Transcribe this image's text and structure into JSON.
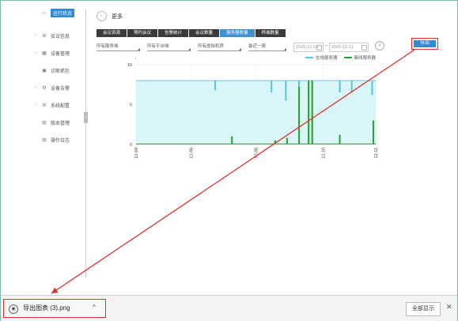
{
  "sidebar": {
    "items": [
      {
        "label": "运行状态",
        "icon": "tv-icon",
        "active": true,
        "expandable": false
      },
      {
        "label": "会议信息",
        "icon": "gear-icon",
        "active": false,
        "expandable": true
      },
      {
        "label": "设备管理",
        "icon": "grid-icon",
        "active": false,
        "expandable": true
      },
      {
        "label": "诊断抓包",
        "icon": "package-icon",
        "active": false,
        "expandable": false
      },
      {
        "label": "设备告警",
        "icon": "gear-icon",
        "active": false,
        "expandable": true
      },
      {
        "label": "系统配置",
        "icon": "gear-icon",
        "active": false,
        "expandable": true
      },
      {
        "label": "版本管理",
        "icon": "document-icon",
        "active": false,
        "expandable": false
      },
      {
        "label": "操作日志",
        "icon": "document-icon",
        "active": false,
        "expandable": false
      }
    ]
  },
  "header": {
    "back": "←",
    "title": "更多"
  },
  "tabs": [
    {
      "label": "会议资源",
      "active": false
    },
    {
      "label": "预约会议",
      "active": false
    },
    {
      "label": "告警统计",
      "active": false
    },
    {
      "label": "会议数量",
      "active": false
    },
    {
      "label": "服务器数量",
      "active": true
    },
    {
      "label": "终端数量",
      "active": false
    }
  ],
  "filters": {
    "domain": "所有服务域",
    "platform": "所有平台域",
    "machine": "所有虚拟机房",
    "range": "最近一周",
    "date_from": "2020-12-04",
    "date_to": "2020-12-11",
    "export_label": "导出"
  },
  "chart_data": {
    "type": "area",
    "series": [
      {
        "name": "在线服务器",
        "color": "#5bc0de"
      },
      {
        "name": "离线服务器",
        "color": "#2ca02c"
      }
    ],
    "x_ticks": [
      "12-04",
      "12-06",
      "12-08",
      "12-10",
      "12-11"
    ],
    "y_ticks": [
      0,
      5,
      10
    ],
    "ylim": [
      0,
      10
    ],
    "online_baseline": 8,
    "online_dips": [
      {
        "x": 0.33,
        "y": 6.8
      },
      {
        "x": 0.565,
        "y": 6.5
      },
      {
        "x": 0.625,
        "y": 5.5
      },
      {
        "x": 0.68,
        "y": 1
      },
      {
        "x": 0.72,
        "y": 0
      },
      {
        "x": 0.735,
        "y": 0
      },
      {
        "x": 0.85,
        "y": 6.5
      },
      {
        "x": 0.9,
        "y": 6.5
      },
      {
        "x": 0.985,
        "y": 6.2
      }
    ],
    "offline_spikes": [
      {
        "x": 0.4,
        "y": 1
      },
      {
        "x": 0.58,
        "y": 0.5
      },
      {
        "x": 0.63,
        "y": 0.8
      },
      {
        "x": 0.68,
        "y": 7.2
      },
      {
        "x": 0.72,
        "y": 8
      },
      {
        "x": 0.735,
        "y": 8
      },
      {
        "x": 0.85,
        "y": 1.2
      },
      {
        "x": 0.99,
        "y": 3
      }
    ],
    "xlabel": "",
    "ylabel": ""
  },
  "download": {
    "file_name": "导出图表 (3).png",
    "show_all": "全部显示",
    "close": "✕",
    "caret": "^"
  }
}
